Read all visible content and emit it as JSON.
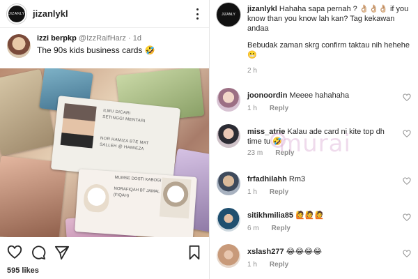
{
  "post": {
    "username": "jizanlykl",
    "brand_avatar_text": "JIZANLY",
    "tweet": {
      "display_name": "izzi berpkp",
      "handle": "@IzzRaifHarz",
      "separator": "·",
      "time": "1d",
      "text": "The 90s kids business cards 🤣"
    },
    "photo_cards": {
      "card1_line1": "ILMU DICARI",
      "card1_line2": "SETINGGI MENTARI",
      "card1_line3": "NOR HAMIZA BTE MAT",
      "card1_line4": "SALLEH @ HAMIEZA",
      "card2_line1": "MUMSE DOSTI KABOGI",
      "card2_line2": "NORAFIQAH BT JAMAL",
      "card2_line3": "(FIQAH)"
    },
    "likes": "595 likes"
  },
  "caption": {
    "username": "jizanlykl",
    "text1": "Hahaha sapa pernah ? 👌🏼👌🏼👌🏼 if you know than you know lah kan? Tag kekawan andaa",
    "text2": "Bebudak zaman skrg confirm taktau nih hehehe 😬",
    "time": "2 h"
  },
  "comments": [
    {
      "username": "joonoordin",
      "text": "Meeee hahahaha",
      "time": "1 h",
      "reply": "Reply"
    },
    {
      "username": "miss_atrie",
      "text": "Kalau ade card ni kite top dh time tu 🤣",
      "time": "23 m",
      "reply": "Reply"
    },
    {
      "username": "frfadhilahh",
      "text": "Rm3",
      "time": "1 h",
      "reply": "Reply"
    },
    {
      "username": "sitikhmilia85",
      "text": "🙋🙋🙋",
      "time": "6 m",
      "reply": "Reply"
    },
    {
      "username": "xslash277",
      "text": "😂😂😂😂",
      "time": "1 h",
      "reply": "Reply"
    }
  ],
  "watermark": "murai",
  "colors": {
    "text": "#262626",
    "muted": "#8e8e8e",
    "watermark": "#d6a0cd"
  },
  "icons": [
    "more-options-icon",
    "heart-icon",
    "comment-icon",
    "share-icon",
    "bookmark-icon"
  ]
}
